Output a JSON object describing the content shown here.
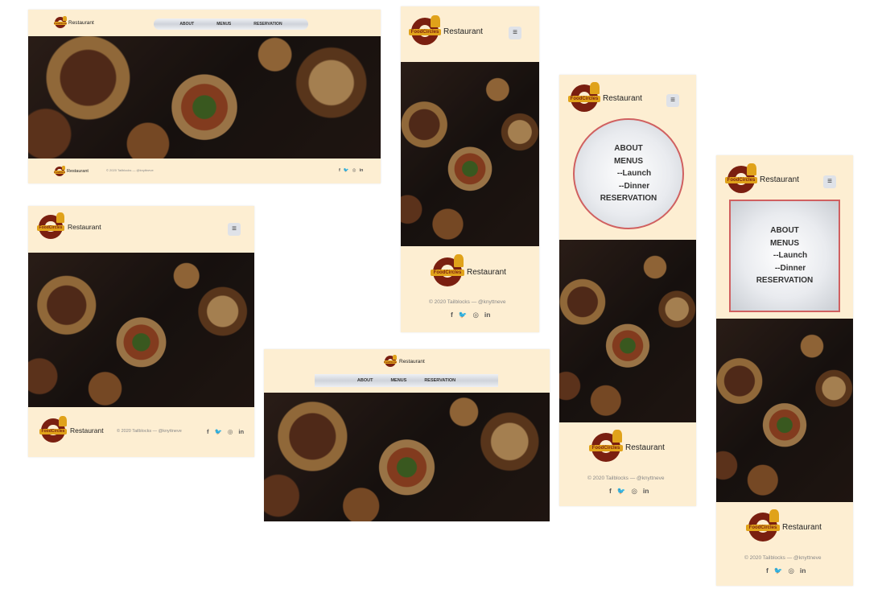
{
  "brand": {
    "name": "Restaurant",
    "logo_text": "FoodCircles"
  },
  "nav": {
    "about": "ABOUT",
    "menus": "MENUS",
    "reservation": "RESERVATION"
  },
  "submenu": {
    "launch": "--Launch",
    "dinner": "--Dinner"
  },
  "menu_button": {
    "icon": "≡"
  },
  "footer": {
    "copyright": "© 2020 Tailblocks — @knyttneve",
    "social": {
      "facebook": "f",
      "twitter": "🐦",
      "instagram": "◎",
      "linkedin": "in"
    }
  },
  "colors": {
    "cream": "#fdeed2",
    "logo_red": "#7a1f10",
    "logo_gold": "#e0a21a",
    "menu_border": "#d06060"
  }
}
